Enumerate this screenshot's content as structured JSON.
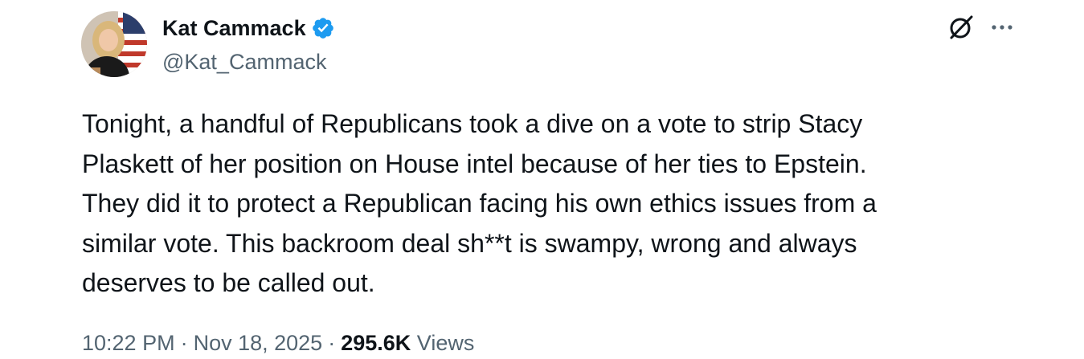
{
  "author": {
    "display_name": "Kat Cammack",
    "handle": "@Kat_Cammack",
    "verified": true,
    "verified_color": "#1d9bf0"
  },
  "icons": {
    "grok": "grok-icon",
    "more": "more-options-icon",
    "verified": "verified-badge-icon"
  },
  "tweet": {
    "text": "Tonight, a handful of Republicans took a dive on a vote to strip Stacy\nPlaskett of her position on House intel because of her ties to Epstein.\nThey did it to protect a Republican facing his own ethics issues from a\nsimilar vote. This backroom deal sh**t is swampy, wrong and always\ndeserves to be called out.",
    "time": "10:22 PM",
    "date": "Nov 18, 2025",
    "separator": "·",
    "views_count": "295.6K",
    "views_label": "Views"
  },
  "colors": {
    "text_primary": "#0f1419",
    "text_secondary": "#536471"
  }
}
